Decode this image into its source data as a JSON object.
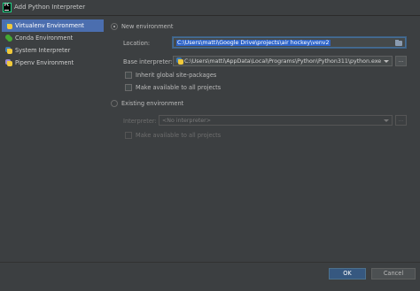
{
  "window": {
    "title": "Add Python Interpreter"
  },
  "sidebar": {
    "items": [
      {
        "label": "Virtualenv Environment",
        "icon": "python-icon"
      },
      {
        "label": "Conda Environment",
        "icon": "conda-icon"
      },
      {
        "label": "System Interpreter",
        "icon": "python-icon"
      },
      {
        "label": "Pipenv Environment",
        "icon": "pipenv-icon"
      }
    ],
    "selected": "Virtualenv Environment"
  },
  "new_env": {
    "radio_label": "New environment",
    "location_label": "Location:",
    "location_value": "C:\\Users\\matti\\Google Drive\\projects\\air hockey\\venv2",
    "base_label": "Base interpreter:",
    "base_value": "C:\\Users\\matti\\AppData\\Local\\Programs\\Python\\Python311\\python.exe",
    "browse_label": "...",
    "inherit_label": "Inherit global site-packages",
    "available_label": "Make available to all projects"
  },
  "existing_env": {
    "radio_label": "Existing environment",
    "interpreter_label": "Interpreter:",
    "interpreter_value": "<No interpreter>",
    "browse_label": "...",
    "available_label": "Make available to all projects"
  },
  "buttons": {
    "ok": "OK",
    "cancel": "Cancel"
  },
  "colors": {
    "accent": "#4b6eaf",
    "primary_button": "#365880",
    "background": "#3c3f41"
  }
}
